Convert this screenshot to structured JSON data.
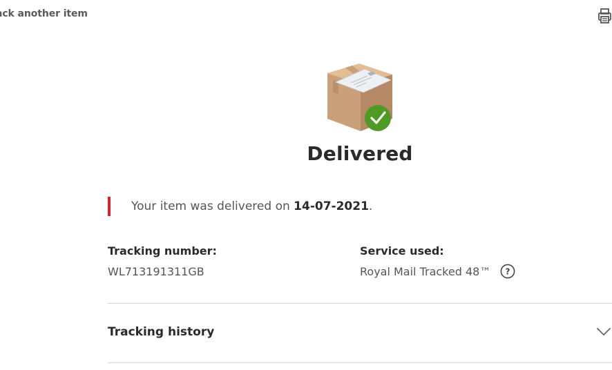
{
  "nav": {
    "track_another_label": "ack another item"
  },
  "toolbar": {
    "print_icon": "printer-icon"
  },
  "status": {
    "title": "Delivered",
    "illustration": "delivered-parcel-icon",
    "check_color": "#4f9a24"
  },
  "message": {
    "prefix": "Your item was delivered on ",
    "date": "14-07-2021",
    "suffix": ".",
    "accent_color": "#da202a"
  },
  "tracking": {
    "label": "Tracking number:",
    "value": "WL713191311GB"
  },
  "service": {
    "label": "Service used:",
    "value": "Royal Mail Tracked 48™",
    "help_icon": "question-mark-icon"
  },
  "history": {
    "label": "Tracking history",
    "expand_icon": "chevron-down-icon"
  }
}
